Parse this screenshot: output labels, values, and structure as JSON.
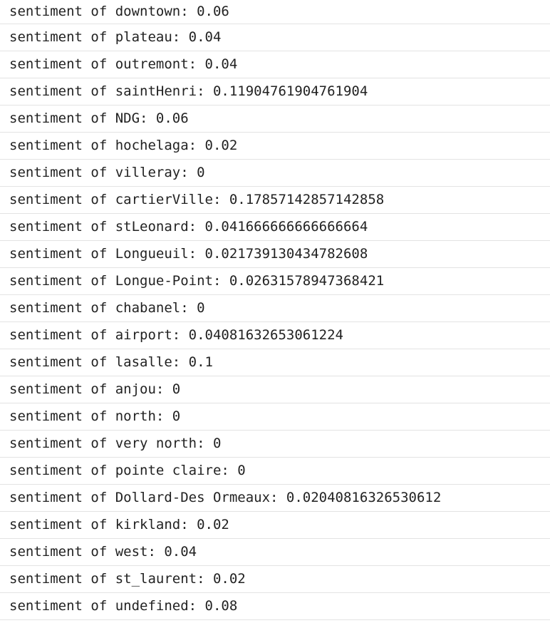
{
  "console": {
    "lines": [
      "sentiment of downtown: 0.06",
      "sentiment of plateau: 0.04",
      "sentiment of outremont: 0.04",
      "sentiment of saintHenri: 0.11904761904761904",
      "sentiment of NDG: 0.06",
      "sentiment of hochelaga: 0.02",
      "sentiment of villeray: 0",
      "sentiment of cartierVille: 0.17857142857142858",
      "sentiment of stLeonard: 0.041666666666666664",
      "sentiment of Longueuil: 0.021739130434782608",
      "sentiment of Longue-Point: 0.02631578947368421",
      "sentiment of chabanel: 0",
      "sentiment of airport: 0.04081632653061224",
      "sentiment of lasalle: 0.1",
      "sentiment of anjou: 0",
      "sentiment of north: 0",
      "sentiment of very north: 0",
      "sentiment of pointe claire: 0",
      "sentiment of Dollard-Des Ormeaux: 0.02040816326530612",
      "sentiment of kirkland: 0.02",
      "sentiment of west: 0.04",
      "sentiment of st_laurent: 0.02",
      "sentiment of undefined: 0.08"
    ]
  }
}
